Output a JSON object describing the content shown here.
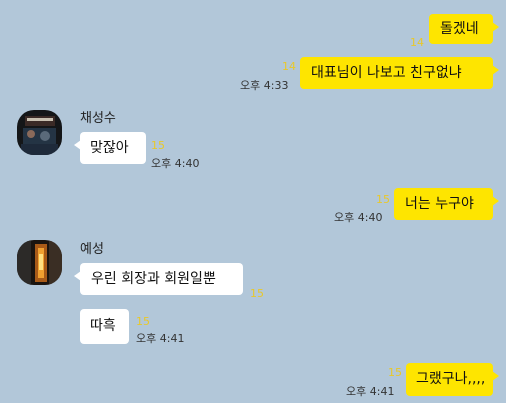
{
  "messages": [
    {
      "side": "me",
      "text": "돌겠네",
      "unread": "14",
      "time": ""
    },
    {
      "side": "me",
      "text": "대표님이 나보고 친구없냐",
      "unread": "14",
      "time": "오후 4:33"
    },
    {
      "side": "other",
      "sender": "채성수",
      "text": "맞잖아",
      "unread": "15",
      "time": "오후 4:40"
    },
    {
      "side": "me",
      "text": "너는 누구야",
      "unread": "15",
      "time": "오후 4:40"
    },
    {
      "side": "other",
      "sender": "예성",
      "text": "우린 회장과 회원일뿐",
      "unread": "15",
      "time": ""
    },
    {
      "side": "other",
      "text": "따흑",
      "unread": "15",
      "time": "오후 4:41"
    },
    {
      "side": "me",
      "text": "그랬구나,,,,",
      "unread": "15",
      "time": "오후 4:41"
    }
  ],
  "colors": {
    "background": "#b2c7d9",
    "my_bubble": "#fee500",
    "other_bubble": "#ffffff",
    "unread": "#e8c82a"
  }
}
